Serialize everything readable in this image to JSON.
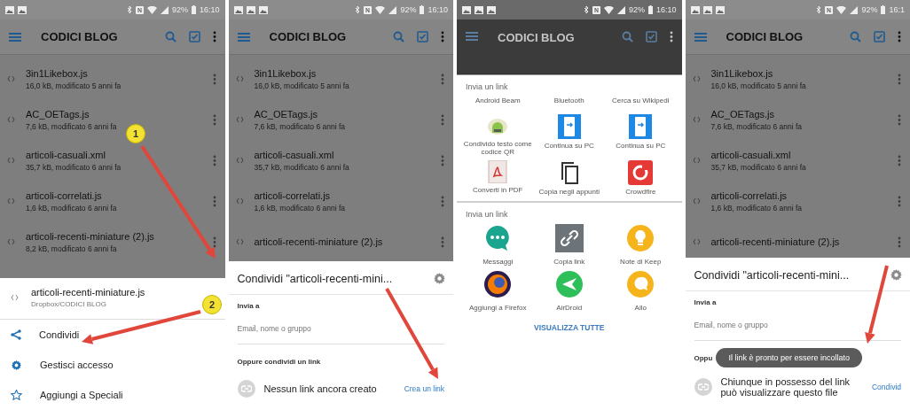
{
  "panels": [
    {
      "kind": "action_menu",
      "status_bar": {
        "battery": "92%",
        "time": "16:10"
      },
      "app_bar": {
        "title": "CODICI BLOG"
      },
      "files": [
        {
          "name": "3in1Likebox.js",
          "details": "16,0 kB, modificato 5 anni fa"
        },
        {
          "name": "AC_OETags.js",
          "details": "7,6 kB, modificato 6 anni fa"
        },
        {
          "name": "articoli-casuali.xml",
          "details": "35,7 kB, modificato 6 anni fa"
        },
        {
          "name": "articoli-correlati.js",
          "details": "1,6 kB, modificato 6 anni fa"
        },
        {
          "name": "articoli-recenti-miniature (2).js",
          "details": "8,2 kB, modificato 6 anni fa"
        }
      ],
      "sheet": {
        "file_name": "articoli-recenti-miniature.js",
        "file_path": "Dropbox/CODICI BLOG",
        "actions": [
          {
            "kind": "share",
            "label": "Condividi"
          },
          {
            "kind": "settings",
            "label": "Gestisci accesso"
          },
          {
            "kind": "star",
            "label": "Aggiungi a Speciali"
          }
        ]
      },
      "callouts": [
        "1",
        "2"
      ]
    },
    {
      "kind": "share_dialog",
      "status_bar": {
        "battery": "92%",
        "time": "16:10"
      },
      "app_bar": {
        "title": "CODICI BLOG"
      },
      "files": [
        {
          "name": "3in1Likebox.js",
          "details": "16,0 kB, modificato 5 anni fa"
        },
        {
          "name": "AC_OETags.js",
          "details": "7,6 kB, modificato 6 anni fa"
        },
        {
          "name": "articoli-casuali.xml",
          "details": "35,7 kB, modificato 6 anni fa"
        },
        {
          "name": "articoli-correlati.js",
          "details": "1,6 kB, modificato 6 anni fa"
        },
        {
          "name": "articoli-recenti-miniature (2).js"
        }
      ],
      "sheet": {
        "title": "Condividi \"articoli-recenti-mini...",
        "send_to_label": "Invia a",
        "recipient_placeholder": "Email, nome o gruppo",
        "link_section_label": "Oppure condividi un link",
        "link_status": "Nessun link ancora creato",
        "link_action": "Crea un link"
      }
    },
    {
      "kind": "share_chooser",
      "status_bar": {
        "battery": "92%",
        "time": "16:10"
      },
      "app_bar": {
        "title": "CODICI BLOG"
      },
      "sections": [
        {
          "title": "Invia un link",
          "targets": [
            {
              "kind": "text",
              "label": "Android Beam"
            },
            {
              "kind": "text",
              "label": "Bluetooth"
            },
            {
              "kind": "text",
              "label": "Cerca su Wikipedi"
            },
            {
              "kind": "qr",
              "label": "Condivido testo come codice QR"
            },
            {
              "kind": "pc",
              "label": "Continua su PC"
            },
            {
              "kind": "pc",
              "label": "Continua su PC"
            },
            {
              "kind": "pdf",
              "label": "Converti in PDF"
            },
            {
              "kind": "copy",
              "label": "Copia negli appunti"
            },
            {
              "kind": "crowdfire",
              "label": "Crowdfire"
            }
          ]
        },
        {
          "title": "Invia un link",
          "targets": [
            {
              "kind": "chat",
              "label": "Messaggi"
            },
            {
              "kind": "link",
              "label": "Copia link"
            },
            {
              "kind": "bulb",
              "label": "Note di Keep"
            },
            {
              "kind": "browser",
              "label": "Aggiungi a Firefox"
            },
            {
              "kind": "send",
              "label": "AirDroid"
            },
            {
              "kind": "bubble",
              "label": "Allo"
            }
          ],
          "button": "VISUALIZZA TUTTE"
        }
      ]
    },
    {
      "kind": "share_dialog",
      "status_bar": {
        "battery": "92%",
        "time": "16:1"
      },
      "app_bar": {
        "title": "CODICI BLOG"
      },
      "files": [
        {
          "name": "3in1Likebox.js",
          "details": "16,0 kB, modificato 5 anni fa"
        },
        {
          "name": "AC_OETags.js",
          "details": "7,6 kB, modificato 6 anni fa"
        },
        {
          "name": "articoli-casuali.xml",
          "details": "35,7 kB, modificato 6 anni fa"
        },
        {
          "name": "articoli-correlati.js",
          "details": "1,6 kB, modificato 6 anni fa"
        },
        {
          "name": "articoli-recenti-miniature (2).js"
        }
      ],
      "sheet": {
        "title": "Condividi \"articoli-recenti-mini...",
        "send_to_label": "Invia a",
        "recipient_placeholder": "Email, nome o gruppo",
        "link_section_label": "Oppu",
        "toast": "Il link è pronto per essere incollato",
        "link_status": "Chiunque in possesso del link può visualizzare questo file",
        "link_action": "Condivid"
      }
    }
  ]
}
